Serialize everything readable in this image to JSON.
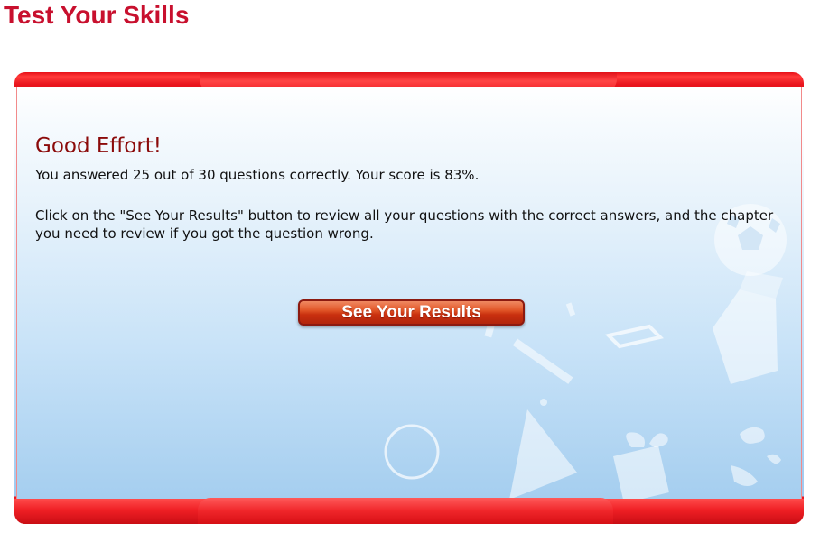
{
  "page": {
    "title": "Test Your Skills"
  },
  "result": {
    "heading": "Good Effort!",
    "score_text": "You answered 25 out of 30 questions correctly. Your score is 83%.",
    "instructions": "Click on the \"See Your Results\" button to review all your questions with the correct answers, and the chapter you need to review if you got the question wrong.",
    "correct": 25,
    "total": 30,
    "score_percent": 83
  },
  "actions": {
    "see_results_label": "See Your Results"
  },
  "colors": {
    "title": "#c8102e",
    "frame_red": "#e8141c",
    "heading": "#8b0a0a",
    "button": "#d5441a",
    "panel_top": "#ffffff",
    "panel_bottom": "#a5ceef"
  },
  "decorations": [
    "soccer-ball-icon",
    "box-icon",
    "triangle-icon",
    "circle-icon",
    "gift-icon",
    "pencil-icon",
    "eraser-icon",
    "globe-icon"
  ]
}
